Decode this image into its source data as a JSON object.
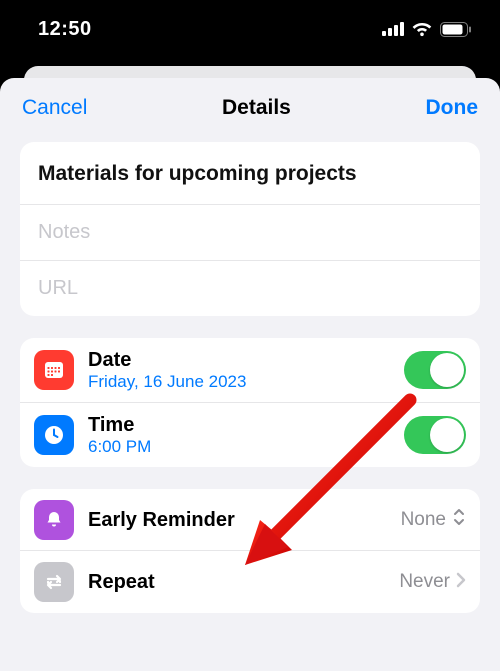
{
  "statusbar": {
    "time": "12:50"
  },
  "nav": {
    "cancel": "Cancel",
    "title": "Details",
    "done": "Done"
  },
  "reminder": {
    "title": "Materials for upcoming projects",
    "notes_placeholder": "Notes",
    "url_placeholder": "URL"
  },
  "schedule": {
    "date_label": "Date",
    "date_value": "Friday, 16 June 2023",
    "time_label": "Time",
    "time_value": "6:00 PM"
  },
  "options": {
    "early_label": "Early Reminder",
    "early_value": "None",
    "repeat_label": "Repeat",
    "repeat_value": "Never"
  }
}
